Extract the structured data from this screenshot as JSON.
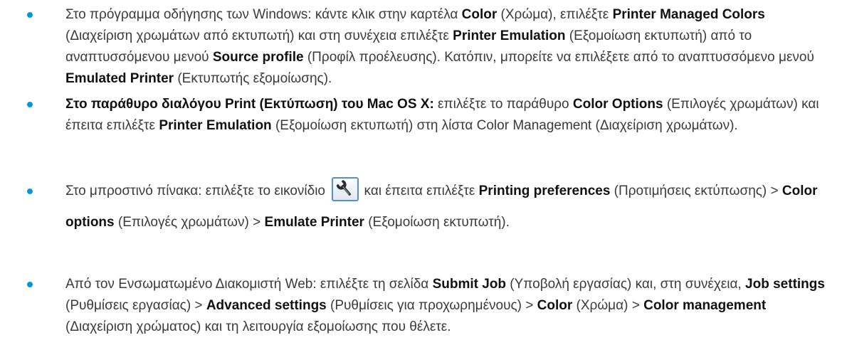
{
  "items": [
    {
      "p1": "Στο πρόγραμμα οδήγησης των Windows: κάντε κλικ στην καρτέλα ",
      "b1": "Color",
      "p2": " (Χρώμα), επιλέξτε ",
      "b2": "Printer Managed Colors",
      "p3": " (Διαχείριση χρωμάτων από εκτυπωτή) και στη συνέχεια επιλέξτε ",
      "b3": "Printer Emulation",
      "p4": " (Εξομοίωση εκτυπωτή) από το αναπτυσσόμενου μενού ",
      "b4": "Source profile",
      "p5": " (Προφίλ προέλευσης). Κατόπιν, μπορείτε να επιλέξετε από το αναπτυσσόμενο μενού ",
      "b5": "Emulated Printer",
      "p6": " (Εκτυπωτής εξομοίωσης)."
    },
    {
      "b1": "Στο παράθυρο διαλόγου Print (Εκτύπωση) του Mac OS X:",
      "p1": " επιλέξτε το παράθυρο ",
      "b2": "Color Options",
      "p2": " (Επιλογές χρωμάτων) και έπειτα επιλέξτε ",
      "b3": "Printer Emulation",
      "p3": " (Εξομοίωση εκτυπωτή) στη λίστα Color Management (Διαχείριση χρωμάτων)."
    },
    {
      "p1": "Στο μπροστινό πίνακα: επιλέξτε το εικονίδιο ",
      "icon": "wrench-icon",
      "p2": " και έπειτα επιλέξτε ",
      "b1": "Printing preferences",
      "p3": " (Προτιμήσεις εκτύπωσης) > ",
      "b2": "Color options",
      "p4": " (Επιλογές χρωμάτων) > ",
      "b3": "Emulate Printer",
      "p5": " (Εξομοίωση εκτυπωτή)."
    },
    {
      "p1": "Από τον Ενσωματωμένο Διακομιστή Web: επιλέξτε τη σελίδα ",
      "b1": "Submit Job",
      "p2": " (Υποβολή εργασίας) και, στη συνέχεια, ",
      "b2": "Job settings",
      "p3": " (Ρυθμίσεις εργασίας) > ",
      "b3": "Advanced settings",
      "p4": " (Ρυθμίσεις για προχωρημένους) > ",
      "b4": "Color",
      "p5": " (Χρώμα) > ",
      "b5": "Color management",
      "p6": " (Διαχείριση χρώματος) και τη λειτουργία εξομοίωσης που θέλετε."
    }
  ],
  "colors": {
    "bullet": "#0a96d6",
    "text": "#3a3a3a",
    "bold": "#111111"
  }
}
